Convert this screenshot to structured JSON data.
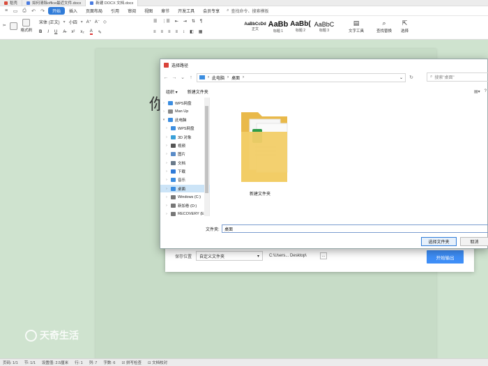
{
  "tabs": [
    {
      "label": "稻壳"
    },
    {
      "label": "如何清除office最近文件.docx"
    },
    {
      "label": "新建 DOCX 文档.docx"
    }
  ],
  "menu": {
    "items": [
      "开始",
      "插入",
      "页面布局",
      "引用",
      "审阅",
      "视图",
      "章节",
      "开发工具",
      "会员专享"
    ],
    "active": "开始",
    "search": "查找命令、搜索模板"
  },
  "ribbon": {
    "format_painter": "格式刷",
    "font_name": "宋体 (正文)",
    "font_size": "小四",
    "styles": [
      {
        "preview": "AaBbCcDd",
        "name": "正文"
      },
      {
        "preview": "AaBb",
        "name": "标题 1"
      },
      {
        "preview": "AaBb(",
        "name": "标题 2"
      },
      {
        "preview": "AaBbC",
        "name": "标题 3"
      }
    ],
    "text_tools": "文字工具",
    "find_replace": "查找替换",
    "select": "选择"
  },
  "document": {
    "visible_text": "你"
  },
  "export_dialog": {
    "save_location_label": "保存位置",
    "save_location_value": "自定义文件夹",
    "path": "C:\\Users... Desktop\\",
    "more": "...",
    "start_button": "开始输出"
  },
  "picker": {
    "title": "选择路径",
    "address": [
      "此电脑",
      "桌面"
    ],
    "search_placeholder": "搜索\"桌面\"",
    "organize": "组织",
    "new_folder": "新建文件夹",
    "tree": [
      {
        "label": "WPS网盘",
        "expanded": false,
        "color": "#3b8de0"
      },
      {
        "label": "Man Up",
        "expanded": false,
        "color": "#888888"
      },
      {
        "label": "此电脑",
        "expanded": true,
        "color": "#3b8de0"
      },
      {
        "label": "WPS网盘",
        "expanded": false,
        "color": "#3b8de0"
      },
      {
        "label": "3D 对象",
        "expanded": false,
        "color": "#3aa0d8"
      },
      {
        "label": "视频",
        "expanded": false,
        "color": "#555555"
      },
      {
        "label": "图片",
        "expanded": false,
        "color": "#5a8cc8"
      },
      {
        "label": "文档",
        "expanded": false,
        "color": "#6a7a8a"
      },
      {
        "label": "下载",
        "expanded": false,
        "color": "#2f7bd8"
      },
      {
        "label": "音乐",
        "expanded": false,
        "color": "#3b8de0"
      },
      {
        "label": "桌面",
        "expanded": false,
        "color": "#3b8de0",
        "selected": true
      },
      {
        "label": "Windows (C:)",
        "expanded": false,
        "color": "#777777"
      },
      {
        "label": "新加卷 (D:)",
        "expanded": false,
        "color": "#777777"
      },
      {
        "label": "RECOVERY (E:)",
        "expanded": false,
        "color": "#777777"
      }
    ],
    "folder_name": "新建文件夹",
    "filename_label": "文件夹:",
    "filename_value": "桌面",
    "select_button": "选择文件夹",
    "cancel_button": "取消"
  },
  "statusbar": {
    "items": [
      "页码: 1/1",
      "节: 1/1",
      "设置值: 2.5厘米",
      "行: 1",
      "列: 7",
      "字数: 6",
      "拼写检查",
      "文档校对"
    ]
  },
  "watermark": "天奇生活"
}
